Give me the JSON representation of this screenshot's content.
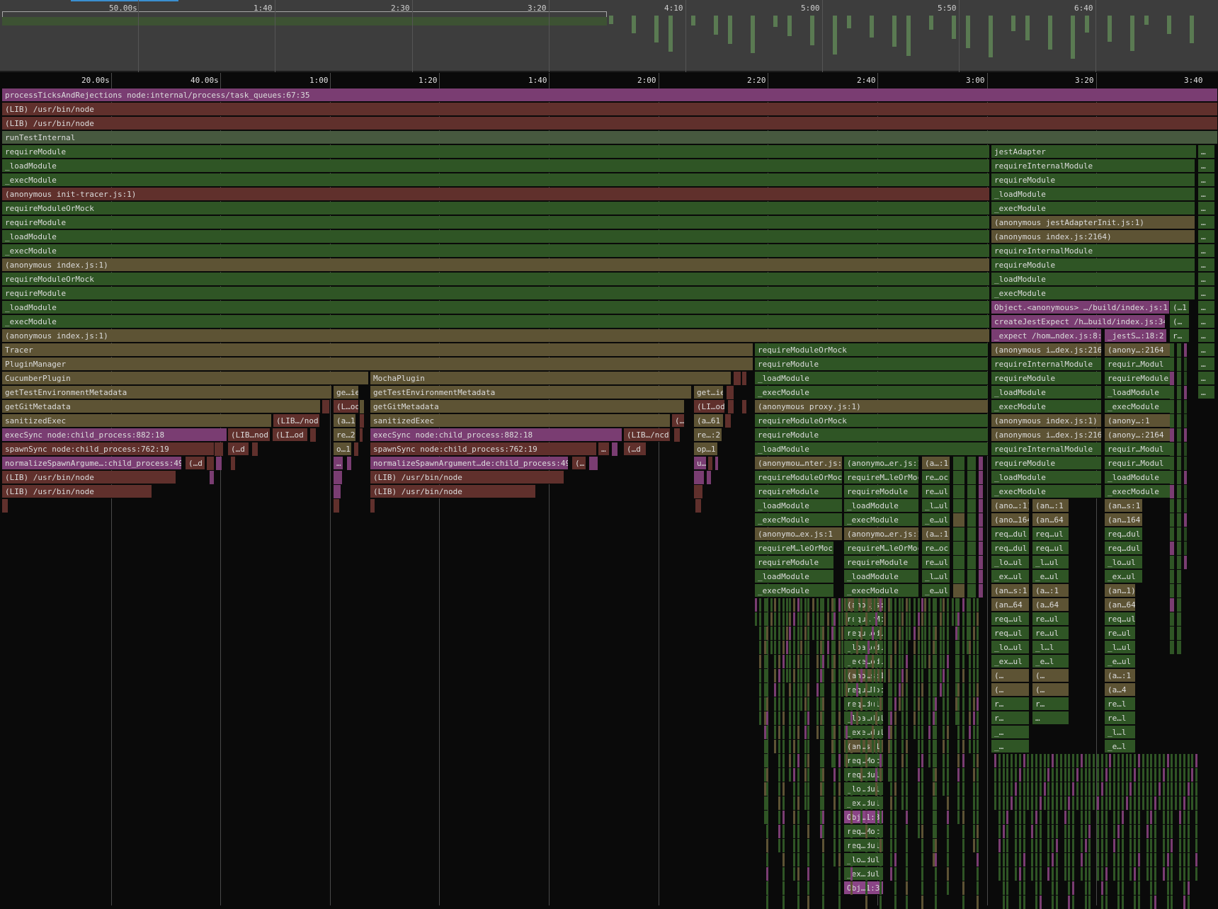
{
  "overview": {
    "tick_labels": [
      "50.00s",
      "1:40",
      "2:30",
      "3:20",
      "4:10",
      "5:00",
      "5:50",
      "6:40"
    ]
  },
  "ruler": {
    "tick_labels": [
      "20.00s",
      "40.00s",
      "1:00",
      "1:20",
      "1:40",
      "2:00",
      "2:20",
      "2:40",
      "3:00",
      "3:20",
      "3:40"
    ]
  },
  "colors": {
    "lib_frame": "#60302c",
    "user_frame": "#2f5525",
    "plugin_frame": "#5d5334",
    "native_frame": "#7a3d72",
    "background": "#0a0a0a"
  },
  "flame": {
    "root": "processTicksAndRejections node:internal/process/task_queues:67:35",
    "lib1": "(LIB) /usr/bin/node",
    "lib2": "(LIB) /usr/bin/node",
    "runTestInternal": "runTestInternal",
    "main_stack": [
      "requireModule",
      "_loadModule",
      "_execModule",
      "(anonymous init-tracer.js:1)",
      "requireModuleOrMock",
      "requireModule",
      "_loadModule",
      "_execModule",
      "(anonymous index.js:1)",
      "requireModuleOrMock",
      "requireModule",
      "_loadModule",
      "_execModule",
      "(anonymous index.js:1)"
    ],
    "tracer": "Tracer",
    "pluginManager": "PluginManager",
    "cucumber": {
      "plugin": "CucumberPlugin",
      "getTestEnv": "getTestEnvironmentMetadata",
      "getGit": "getGitMetadata",
      "sanitized": "sanitizedExec",
      "execSync": "execSync node:child_process:882:18",
      "spawnSync": "spawnSync node:child_process:762:19",
      "normalize": "normalizeSpawnArgume…:child_process:496:3",
      "lib_a": "(LIB) /usr/bin/node",
      "lib_b": "(LIB) /usr/bin/node",
      "side_lib1": "(LIB…/nod",
      "side_lib2": "(LIB…nod",
      "side_lib3": "(LI…od",
      "side_d1": "(…d",
      "side_d2": "(…d",
      "small_geie": "ge…ie",
      "small_lod": "(L…od",
      "small_a1": "(a…1",
      "small_re2": "re…2",
      "small_o1": "o…1",
      "small_dots": "…"
    },
    "mocha": {
      "plugin": "MochaPlugin",
      "getTestEnv": "getTestEnvironmentMetadata",
      "getGit": "getGitMetadata",
      "sanitized": "sanitizedExec",
      "execSync": "execSync node:child_process:882:18",
      "spawnSync": "spawnSync node:child_process:762:19",
      "normalize": "normalizeSpawnArgument…de:child_process:496:3",
      "lib_a": "(LIB) /usr/bin/node",
      "lib_b": "(LIB) /usr/bin/node",
      "side_lib": "(LIB…/ncd",
      "side_d": "(…d",
      "side_paren": "(…",
      "side_dots": "…",
      "small_getie": "get…ie",
      "small_liod": "(LI…od",
      "small_a61": "(a…61",
      "small_re2": "re…:2",
      "small_op1": "op…1",
      "small_u": "u…"
    },
    "mid": {
      "col1": [
        "requireModuleOrMock",
        "requireModule",
        "_loadModule",
        "_execModule",
        "(anonymous proxy.js:1)",
        "requireModuleOrMock",
        "requireModule",
        "_loadModule",
        "(anonymou…nter.js:1",
        "requireModuleOrMock",
        "requireModule",
        "_loadModule",
        "_execModule",
        "(anonymo…ex.js:1",
        "requireM…leOrMoc",
        "requireModule",
        "_loadModule",
        "_execModule"
      ],
      "col2": [
        "(anonymo…er.js:1",
        "requireM…leOrMoc",
        "requireModule",
        "_loadModule",
        "_execModule",
        "(anonymo…er.js:1",
        "requireM…leOrMoc",
        "requireModule",
        "_loadModule",
        "_execModule",
        "(ano…js:1",
        "requ…rMoc",
        "requ…odul",
        "_loa…odul",
        "_exe…odul",
        "(ano…s:1",
        "requ…Moc",
        "req…dul",
        "_loa…dul",
        "_exe…dul",
        "(an…s:1",
        "req…Moc",
        "req…dul",
        "_lo…dul",
        "_ex…dul",
        "Obj…1:3",
        "req…Moc",
        "req…dul",
        "_lo…dul",
        "_ex…dul",
        "Obj…1:3"
      ],
      "col3": [
        "(a…:1",
        "re…oc",
        "re…ul",
        "_l…ul",
        "_e…ul",
        "(a…:1",
        "re…oc",
        "re…ul",
        "_l…ul",
        "_e…ul"
      ]
    },
    "right": {
      "jest": [
        "jestAdapter",
        "requireInternalModule",
        "requireModule",
        "_loadModule",
        "_execModule",
        "(anonymous jestAdapterInit.js:1)",
        "(anonymous index.js:2164)",
        "requireInternalModule",
        "requireModule",
        "_loadModule",
        "_execModule"
      ],
      "objAnon": "Object.<anonymous> …/build/index.js:1:3",
      "createJest": "createJestExpect /h…build/index.js:34:2",
      "expect": "_expect /hom…ndex.js:8:1",
      "jestS": "_jestS…:18:2",
      "colA": [
        "(anonymous i…dex.js:2164",
        "requireInternalModule",
        "requireModule",
        "_loadModule",
        "_execModule",
        "(anonymous index.js:1)",
        "(anonymous i…dex.js:2164",
        "requireInternalModule",
        "requireModule",
        "_loadModule",
        "_execModule"
      ],
      "colB": [
        "(anony…:2164",
        "requir…Modul",
        "requireModule",
        "_loadModule",
        "_execModule",
        "(anony…:1",
        "(anony…:2164",
        "requir…Modul",
        "requir…Modul",
        "_loadModule",
        "_execModule",
        "(an…s:1",
        "(an…164",
        "req…dul",
        "req…dul",
        "_lo…ul",
        "_ex…ul",
        "(an…1)",
        "(an…64",
        "req…ul",
        "re…ul",
        "_l…ul",
        "_e…ul",
        "(a…:1",
        "(a…4",
        "re…l",
        "re…l",
        "_l…l",
        "_e…l"
      ],
      "colA2": [
        "(ano…:1)",
        "(ano…164",
        "req…dul",
        "req…dul",
        "_lo…ul",
        "_ex…ul",
        "(an…s:1",
        "(an…64",
        "req…ul",
        "req…ul",
        "_lo…ul",
        "_ex…ul",
        "(…",
        "(…",
        "r…",
        "r…",
        "_…",
        "_…"
      ],
      "colA3": [
        "(an…:1",
        "(an…64",
        "req…ul",
        "req…ul",
        "_l…ul",
        "_e…ul",
        "(a…:1",
        "(a…64",
        "re…ul",
        "re…ul",
        "_l…l",
        "_e…l",
        "(…",
        "(…",
        "r…",
        "…"
      ],
      "tiny_r": "r…",
      "tiny_dots": "…",
      "tiny_l": "(…",
      "tiny_1": "(…1"
    }
  }
}
